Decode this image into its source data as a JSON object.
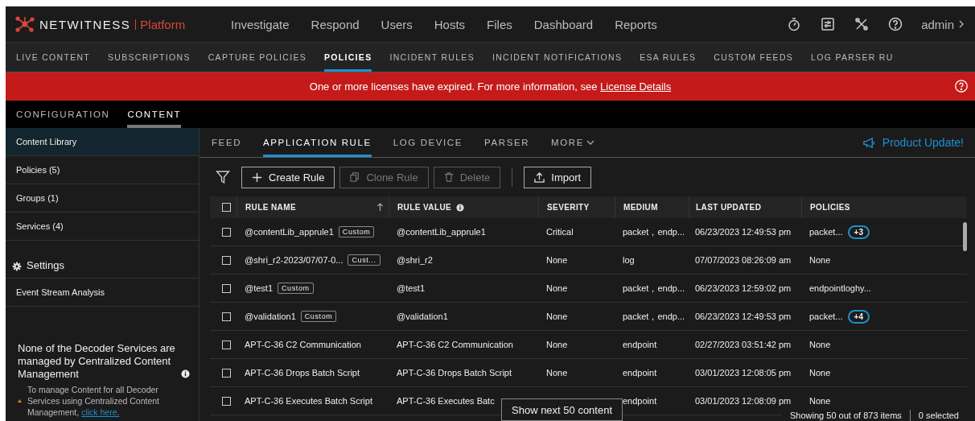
{
  "header": {
    "brand": "NETWITNESS",
    "product": "Platform",
    "nav": [
      "Investigate",
      "Respond",
      "Users",
      "Hosts",
      "Files",
      "Dashboard",
      "Reports"
    ],
    "user": "admin"
  },
  "subnav": [
    {
      "label": "LIVE CONTENT",
      "selected": false
    },
    {
      "label": "SUBSCRIPTIONS",
      "selected": false
    },
    {
      "label": "CAPTURE POLICIES",
      "selected": false
    },
    {
      "label": "POLICIES",
      "selected": true
    },
    {
      "label": "INCIDENT RULES",
      "selected": false
    },
    {
      "label": "INCIDENT NOTIFICATIONS",
      "selected": false
    },
    {
      "label": "ESA RULES",
      "selected": false
    },
    {
      "label": "CUSTOM FEEDS",
      "selected": false
    },
    {
      "label": "LOG PARSER RU",
      "selected": false
    }
  ],
  "banner": {
    "text": "One or more licenses have expired. For more information, see ",
    "link": "License Details"
  },
  "section_tabs": [
    {
      "label": "CONFIGURATION",
      "selected": false
    },
    {
      "label": "CONTENT",
      "selected": true
    }
  ],
  "sidebar": {
    "items": [
      {
        "label": "Content Library",
        "selected": true
      },
      {
        "label": "Policies (5)",
        "selected": false
      },
      {
        "label": "Groups (1)",
        "selected": false
      },
      {
        "label": "Services (4)",
        "selected": false
      }
    ],
    "settings_title": "Settings",
    "settings_items": [
      {
        "label": "Event Stream Analysis",
        "selected": false
      }
    ],
    "notice_title": "None of the Decoder Services are managed by Centralized Content Management",
    "notice_text": "To manage Content for all Decoder Services using Centralized Content Management, ",
    "notice_link": "click here."
  },
  "content_tabs": [
    {
      "label": "FEED",
      "selected": false
    },
    {
      "label": "APPLICATION RULE",
      "selected": true
    },
    {
      "label": "LOG DEVICE",
      "selected": false
    },
    {
      "label": "PARSER",
      "selected": false
    }
  ],
  "more_tab": "MORE",
  "product_update": "Product Update!",
  "toolbar": [
    {
      "label": "Create Rule",
      "kind": "create",
      "disabled": false
    },
    {
      "label": "Clone Rule",
      "kind": "clone",
      "disabled": true
    },
    {
      "label": "Delete",
      "kind": "delete",
      "disabled": true
    },
    {
      "label": "Import",
      "kind": "import",
      "disabled": false
    }
  ],
  "table": {
    "select_all_checked": false,
    "columns": [
      "RULE NAME",
      "RULE VALUE",
      "SEVERITY",
      "MEDIUM",
      "LAST UPDATED",
      "POLICIES"
    ],
    "rows": [
      {
        "checked": false,
        "name": "@contentLib_apprule1",
        "tag": "Custom",
        "value": "@contentLib_apprule1",
        "severity": "Critical",
        "medium": "packet，endp...",
        "updated": "06/23/2023 12:49:53 pm",
        "policies": "packet...",
        "more": "+3"
      },
      {
        "checked": false,
        "name": "@shri_r2-2023/07/07-0...",
        "tag": "Cust...",
        "value": "@shri_r2",
        "severity": "None",
        "medium": "log",
        "updated": "07/07/2023 08:26:09 am",
        "policies": "None"
      },
      {
        "checked": false,
        "name": "@test1",
        "tag": "Custom",
        "value": "@test1",
        "severity": "None",
        "medium": "packet，endp...",
        "updated": "06/23/2023 12:59:02 pm",
        "policies": "endpointloghy..."
      },
      {
        "checked": false,
        "name": "@validation1",
        "tag": "Custom",
        "value": "@validation1",
        "severity": "None",
        "medium": "packet，endp...",
        "updated": "06/23/2023 12:49:53 pm",
        "policies": "packet...",
        "more": "+4"
      },
      {
        "checked": false,
        "name": "APT-C-36 C2 Communication",
        "value": "APT-C-36 C2 Communication",
        "severity": "None",
        "medium": "endpoint",
        "updated": "02/27/2023 03:51:42 pm",
        "policies": "None"
      },
      {
        "checked": false,
        "name": "APT-C-36 Drops Batch Script",
        "value": "APT-C-36 Drops Batch Script",
        "severity": "None",
        "medium": "endpoint",
        "updated": "03/01/2023 12:08:05 pm",
        "policies": "None"
      },
      {
        "checked": false,
        "name": "APT-C-36 Executes Batch Script",
        "value": "APT-C-36 Executes Batc",
        "medium": "endpoint",
        "updated": "03/01/2023 12:08:09 pm",
        "policies": "None"
      }
    ]
  },
  "show_next": "Show next 50 content",
  "footer": {
    "count": "Showing 50 out of 873 items",
    "selected": "0 selected"
  }
}
